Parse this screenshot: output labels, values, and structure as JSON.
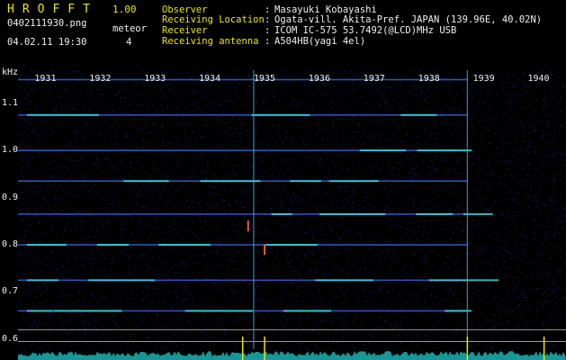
{
  "header": {
    "app_title": "HROFFT",
    "version": "1.00",
    "file_name": "0402111930.png",
    "date_time": "04.02.11 19:30",
    "meteor_label": "meteor",
    "meteor_count": "4",
    "observer_label": "Observer",
    "observer_value": "Masayuki Kobayashi",
    "location_label": "Receiving Location",
    "location_value": "Ogata-vill. Akita-Pref. JAPAN (139.96E, 40.02N)",
    "receiver_label": "Receiver",
    "receiver_value": "ICOM IC-575 53.7492(@LCD)MHz USB",
    "antenna_label": "Receiving antenna",
    "antenna_value": "A504HB(yagi 4el)",
    "colon": ":"
  },
  "colors": {
    "background": "#000000",
    "title": "#e8e800",
    "label": "#e8e800",
    "value": "#f0f0f0",
    "signal": "#40e0e0",
    "noise": "#1a1a70"
  },
  "chart_data": {
    "type": "heatmap",
    "ylabel": "kHz",
    "x_ticks": [
      "1931",
      "1932",
      "1933",
      "1934",
      "1935",
      "1936",
      "1937",
      "1938",
      "1939",
      "1940"
    ],
    "x_range_minutes": [
      1930.5,
      1940.5
    ],
    "y_ticks": [
      "1.1",
      "1.0",
      "0.9",
      "0.8",
      "0.7",
      "0.6"
    ],
    "y_tick_values": [
      1.1,
      1.0,
      0.9,
      0.8,
      0.7,
      0.6
    ],
    "y_range_khz": [
      0.575,
      1.17
    ],
    "carrier_lines_khz": [
      1.15,
      1.075,
      1.0,
      0.935,
      0.865,
      0.8,
      0.725,
      0.66
    ],
    "reference_lines_khz": [
      0.62,
      0.595
    ],
    "vertical_spikes_minute": [
      1934.8,
      1938.7
    ],
    "meteor_echoes": [
      {
        "minute": 1935.0,
        "khz": 0.79
      },
      {
        "minute": 1934.7,
        "khz": 0.84
      }
    ]
  }
}
